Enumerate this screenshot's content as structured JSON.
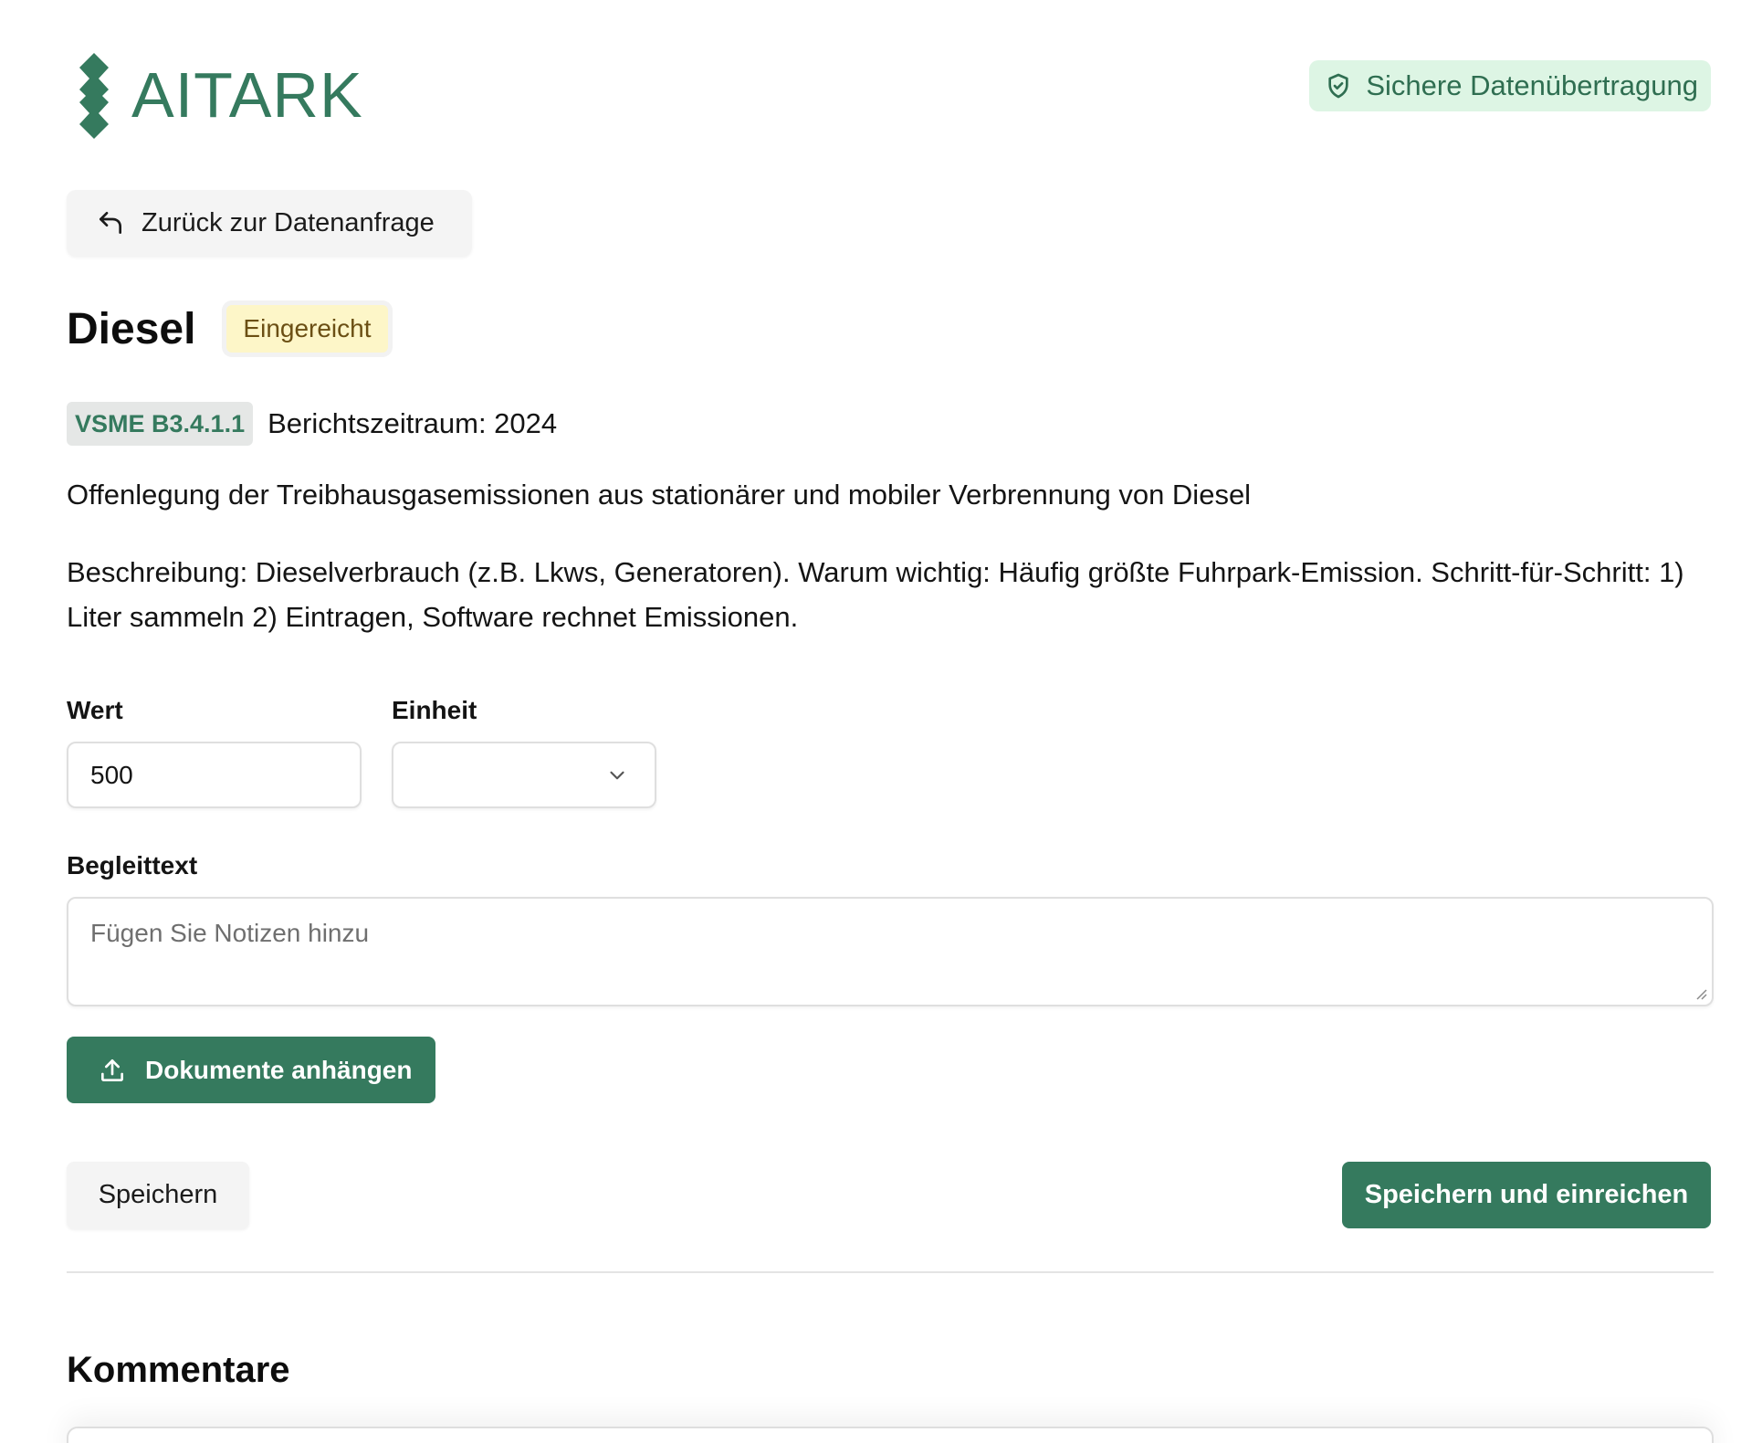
{
  "header": {
    "brand": "AITARK",
    "secure_label": "Sichere Datenübertragung",
    "colors": {
      "brand": "#357a5e",
      "secure_bg": "#ddf5e4"
    }
  },
  "nav": {
    "back_label": "Zurück zur Datenanfrage"
  },
  "item": {
    "title": "Diesel",
    "status": "Eingereicht",
    "code": "VSME B3.4.1.1",
    "period": "Berichtszeitraum: 2024",
    "summary": "Offenlegung der Treibhausgasemissionen aus stationärer und mobiler Verbrennung von Diesel",
    "description": "Beschreibung: Dieselverbrauch (z.B. Lkws, Generatoren). Warum wichtig: Häufig größte Fuhrpark-Emission. Schritt-für-Schritt: 1) Liter sammeln 2) Eintragen, Software rechnet Emissionen."
  },
  "form": {
    "value_label": "Wert",
    "value": "500",
    "unit_label": "Einheit",
    "unit_value": "",
    "notes_label": "Begleittext",
    "notes_placeholder": "Fügen Sie Notizen hinzu",
    "upload_label": "Dokumente anhängen"
  },
  "actions": {
    "save_label": "Speichern",
    "submit_label": "Speichern und einreichen"
  },
  "comments": {
    "title": "Kommentare"
  },
  "icons": [
    "shield-check-icon",
    "back-arrow-icon",
    "chevron-down-icon",
    "upload-icon",
    "resize-grip-icon"
  ]
}
